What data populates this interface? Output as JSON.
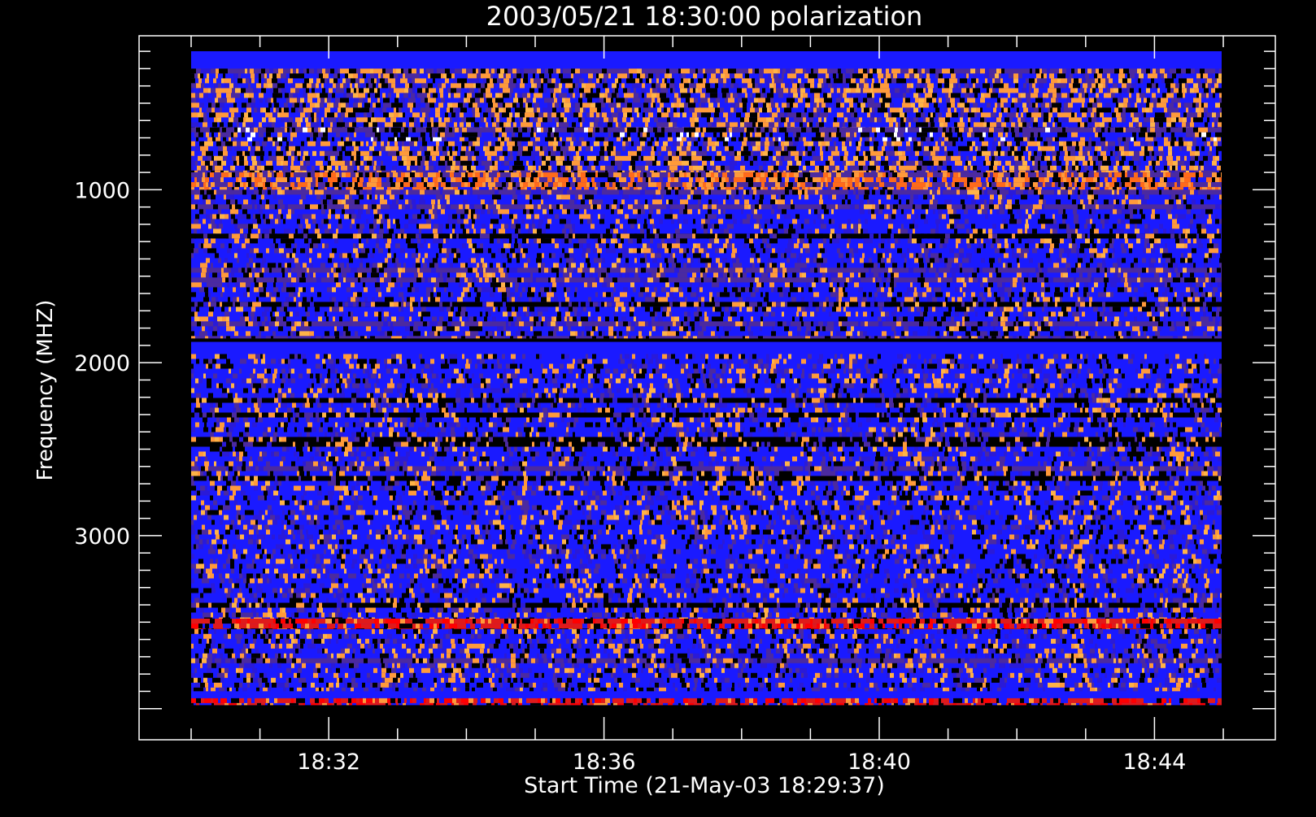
{
  "chart_data": {
    "type": "heatmap",
    "title": "2003/05/21 18:30:00 polarization",
    "xlabel": "Start Time (21-May-03 18:29:37)",
    "ylabel": "Frequency (MHZ)",
    "x_tick_labels": [
      "18:32",
      "18:36",
      "18:40",
      "18:44"
    ],
    "y_tick_labels": [
      "1000",
      "2000",
      "3000"
    ],
    "y_ticks": [
      1000,
      2000,
      3000
    ],
    "y_range_displayed": [
      110,
      4180
    ],
    "data_extent_freq": [
      200,
      3980
    ],
    "colors": {
      "background": "#000000",
      "axes": "#ffffff",
      "base": "#1a1aff",
      "palette": [
        "#1a1aff",
        "#0000ff",
        "#2a1ad8",
        "#4b2aa0",
        "#000000",
        "#ff9a3a",
        "#ff6a1a",
        "#ffb347",
        "#e01a1a",
        "#ff0000",
        "#ffffff"
      ]
    },
    "bands": [
      {
        "f": [
          200,
          300
        ],
        "kind": "solid",
        "color": "#1a1aff"
      },
      {
        "f": [
          300,
          640
        ],
        "kind": "noise-heavy"
      },
      {
        "f": [
          640,
          720
        ],
        "kind": "stripes"
      },
      {
        "f": [
          720,
          900
        ],
        "kind": "noise-heavy"
      },
      {
        "f": [
          900,
          1000
        ],
        "kind": "orange-burst"
      },
      {
        "f": [
          1000,
          1860
        ],
        "kind": "noise-medium"
      },
      {
        "f": [
          1860,
          1880
        ],
        "kind": "solid",
        "color": "#000000"
      },
      {
        "f": [
          1880,
          1950
        ],
        "kind": "solid",
        "color": "#1a1aff"
      },
      {
        "f": [
          1950,
          3480
        ],
        "kind": "noise-medium"
      },
      {
        "f": [
          3480,
          3540
        ],
        "kind": "red-stripes"
      },
      {
        "f": [
          3540,
          3900
        ],
        "kind": "noise-medium"
      },
      {
        "f": [
          3900,
          3940
        ],
        "kind": "solid",
        "color": "#1a1aff"
      },
      {
        "f": [
          3940,
          3980
        ],
        "kind": "red-stripes"
      }
    ]
  }
}
